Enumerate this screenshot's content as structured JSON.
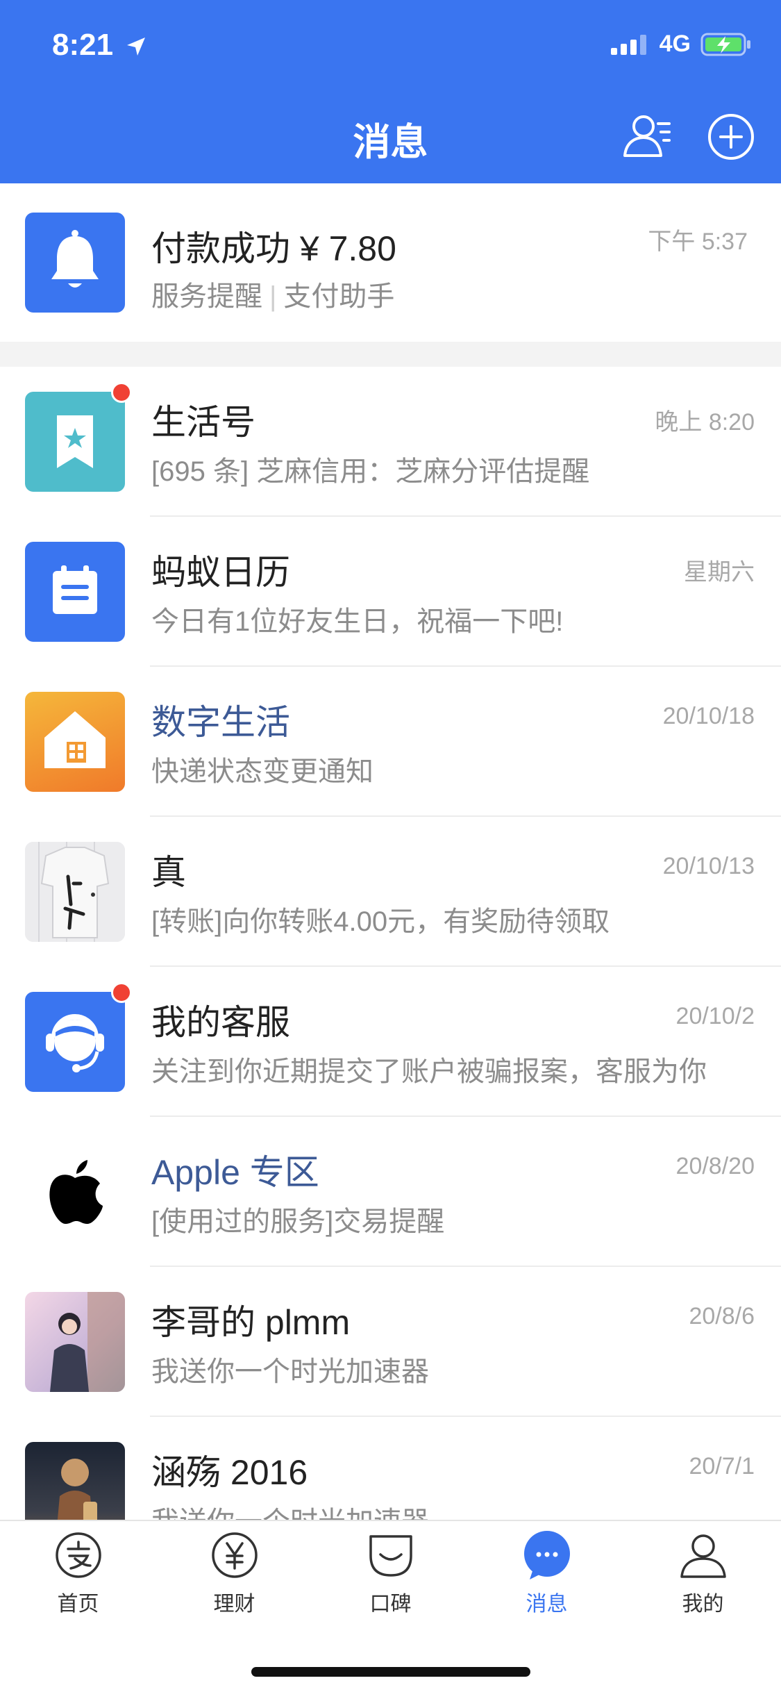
{
  "status_bar": {
    "time": "8:21",
    "network": "4G"
  },
  "header": {
    "title": "消息"
  },
  "top_message": {
    "title": "付款成功 ¥ 7.80",
    "time": "下午 5:37",
    "sub_left": "服务提醒",
    "sub_right": "支付助手"
  },
  "messages": [
    {
      "name": "生活号",
      "time": "晚上 8:20",
      "preview": "[695 条] 芝麻信用：芝麻分评估提醒"
    },
    {
      "name": "蚂蚁日历",
      "time": "星期六",
      "preview": "今日有1位好友生日，祝福一下吧!"
    },
    {
      "name": "数字生活",
      "time": "20/10/18",
      "preview": "快递状态变更通知"
    },
    {
      "name": "真",
      "time": "20/10/13",
      "preview": "[转账]向你转账4.00元，有奖励待领取"
    },
    {
      "name": "我的客服",
      "time": "20/10/2",
      "preview": "关注到你近期提交了账户被骗报案，客服为你"
    },
    {
      "name": "Apple 专区",
      "time": "20/8/20",
      "preview": "[使用过的服务]交易提醒"
    },
    {
      "name": "李哥的 plmm",
      "time": "20/8/6",
      "preview": "我送你一个时光加速器"
    },
    {
      "name": "涵殇 2016",
      "time": "20/7/1",
      "preview": "我送你一个时光加速器"
    }
  ],
  "tabs": [
    {
      "label": "首页"
    },
    {
      "label": "理财"
    },
    {
      "label": "口碑"
    },
    {
      "label": "消息"
    },
    {
      "label": "我的"
    }
  ],
  "colors": {
    "brand_blue": "#3a75f0",
    "badge_red": "#f04134",
    "link_name": "#3d5a96"
  }
}
